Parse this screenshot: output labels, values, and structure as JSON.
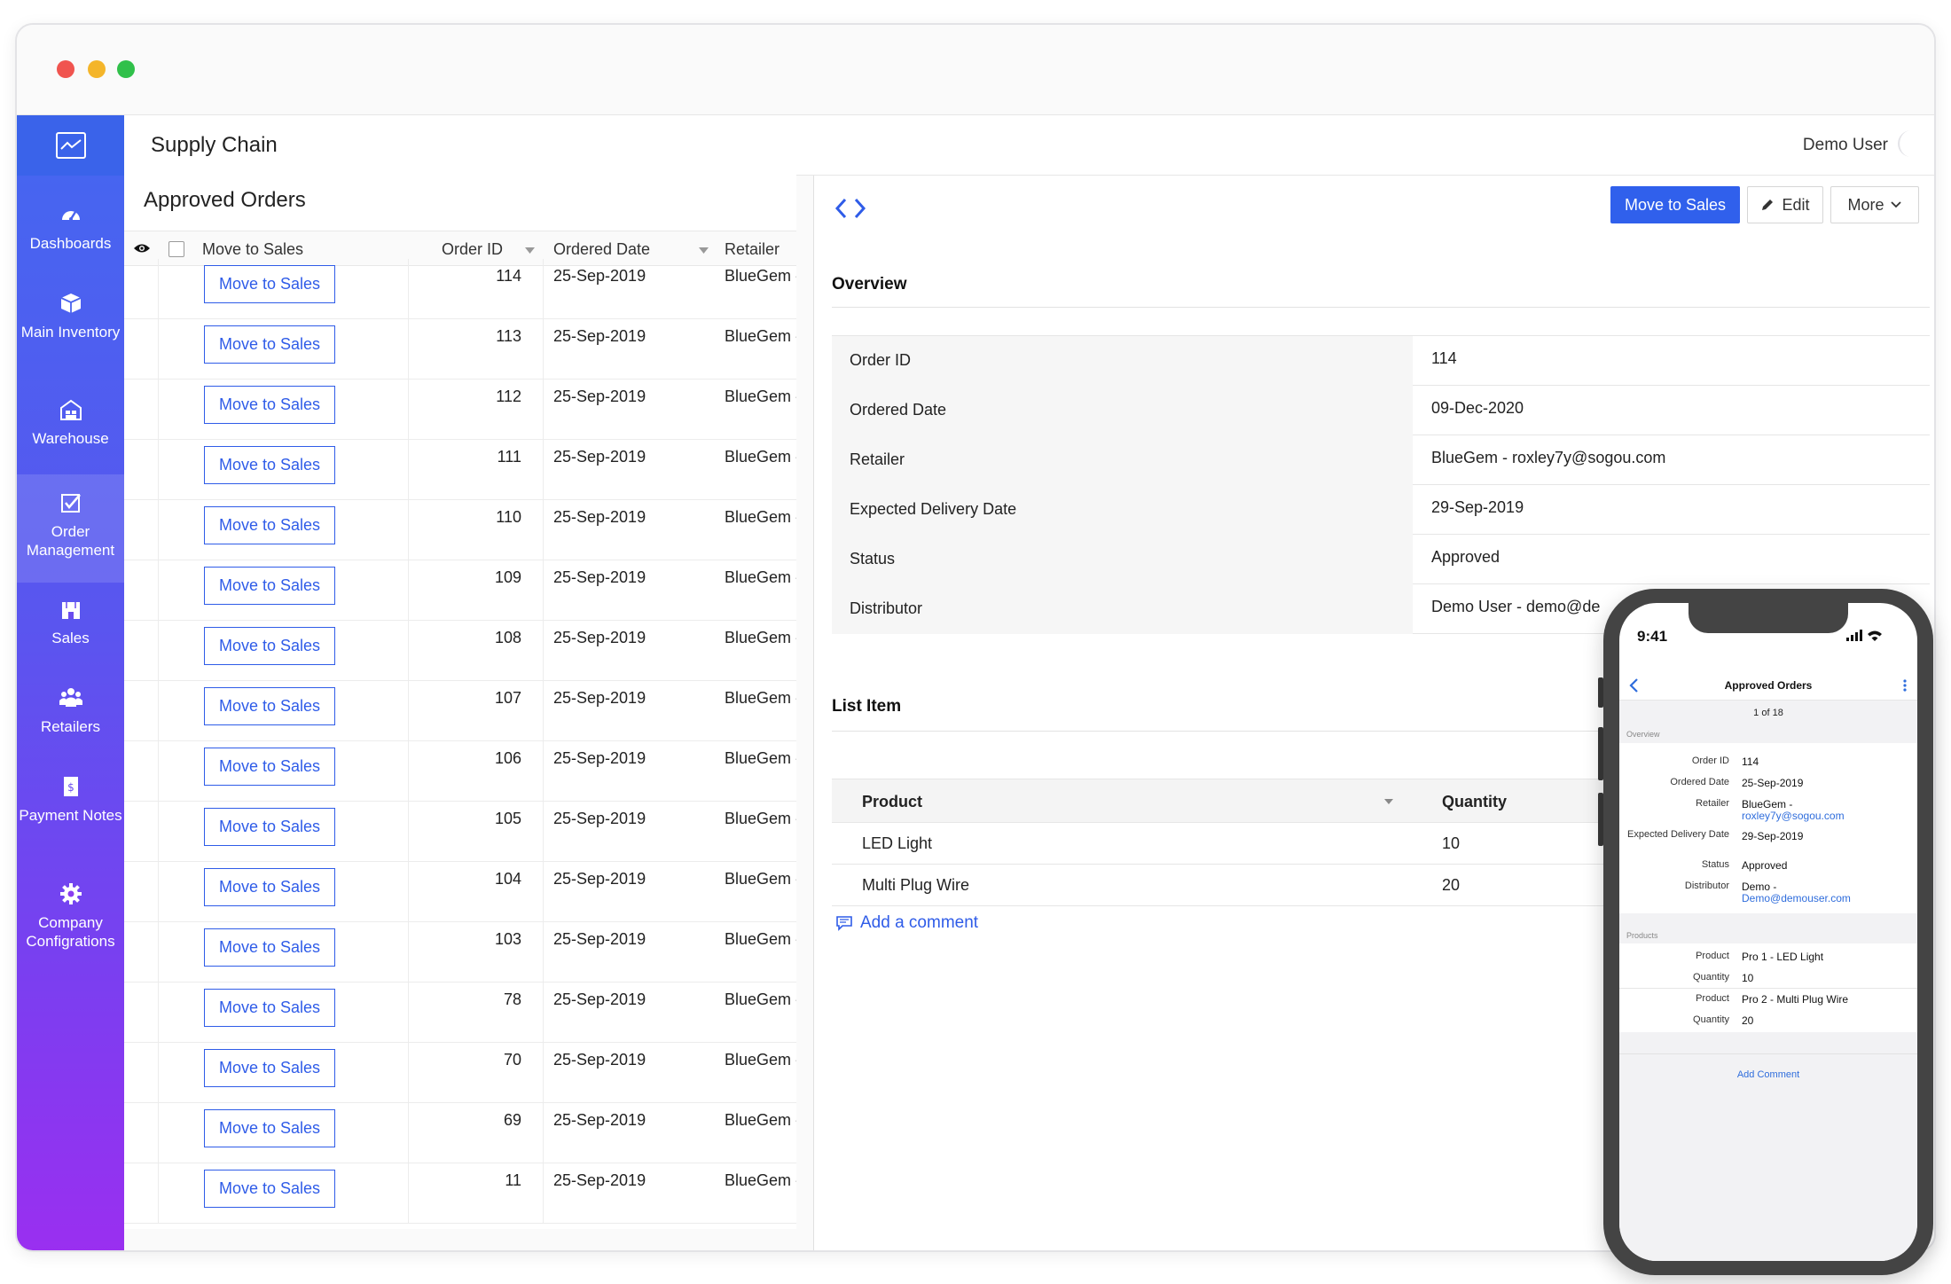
{
  "app": {
    "title": "Supply Chain",
    "user": "Demo User"
  },
  "sidebar": {
    "items": [
      {
        "label": "Dashboards",
        "icon": "gauge-icon"
      },
      {
        "label": "Main Inventory",
        "icon": "box-icon"
      },
      {
        "label": "Warehouse",
        "icon": "warehouse-icon"
      },
      {
        "label": "Order Management",
        "icon": "checkbox-icon",
        "active": true
      },
      {
        "label": "Sales",
        "icon": "store-icon"
      },
      {
        "label": "Retailers",
        "icon": "people-icon"
      },
      {
        "label": "Payment Notes",
        "icon": "dollar-note-icon"
      },
      {
        "label": "Company Configrations",
        "icon": "gear-icon"
      }
    ]
  },
  "list": {
    "title": "Approved Orders",
    "columns": [
      "Move to Sales",
      "Order ID",
      "Ordered Date",
      "Retailer"
    ],
    "button_label": "Move to Sales",
    "rows": [
      {
        "id": "114",
        "date": "25-Sep-2019",
        "retailer": "BlueGem -"
      },
      {
        "id": "113",
        "date": "25-Sep-2019",
        "retailer": "BlueGem -"
      },
      {
        "id": "112",
        "date": "25-Sep-2019",
        "retailer": "BlueGem -"
      },
      {
        "id": "111",
        "date": "25-Sep-2019",
        "retailer": "BlueGem -"
      },
      {
        "id": "110",
        "date": "25-Sep-2019",
        "retailer": "BlueGem -"
      },
      {
        "id": "109",
        "date": "25-Sep-2019",
        "retailer": "BlueGem -"
      },
      {
        "id": "108",
        "date": "25-Sep-2019",
        "retailer": "BlueGem -"
      },
      {
        "id": "107",
        "date": "25-Sep-2019",
        "retailer": "BlueGem -"
      },
      {
        "id": "106",
        "date": "25-Sep-2019",
        "retailer": "BlueGem -"
      },
      {
        "id": "105",
        "date": "25-Sep-2019",
        "retailer": "BlueGem -"
      },
      {
        "id": "104",
        "date": "25-Sep-2019",
        "retailer": "BlueGem -"
      },
      {
        "id": "103",
        "date": "25-Sep-2019",
        "retailer": "BlueGem -"
      },
      {
        "id": "78",
        "date": "25-Sep-2019",
        "retailer": "BlueGem -"
      },
      {
        "id": "70",
        "date": "25-Sep-2019",
        "retailer": "BlueGem -"
      },
      {
        "id": "69",
        "date": "25-Sep-2019",
        "retailer": "BlueGem -"
      },
      {
        "id": "11",
        "date": "25-Sep-2019",
        "retailer": "BlueGem -"
      }
    ]
  },
  "detail": {
    "actions": {
      "primary": "Move to Sales",
      "edit": "Edit",
      "more": "More"
    },
    "overview_title": "Overview",
    "overview": [
      {
        "label": "Order ID",
        "value": "114"
      },
      {
        "label": "Ordered Date",
        "value": "09-Dec-2020"
      },
      {
        "label": "Retailer",
        "value": "BlueGem - roxley7y@sogou.com"
      },
      {
        "label": "Expected Delivery Date",
        "value": "29-Sep-2019"
      },
      {
        "label": "Status",
        "value": "Approved"
      },
      {
        "label": "Distributor",
        "value": "Demo User - demo@de"
      }
    ],
    "list_item_title": "List Item",
    "list_item_columns": [
      "Product",
      "Quantity"
    ],
    "list_items": [
      {
        "product": "LED Light",
        "quantity": "10"
      },
      {
        "product": "Multi Plug Wire",
        "quantity": "20"
      }
    ],
    "add_comment": "Add a comment"
  },
  "phone": {
    "time": "9:41",
    "title": "Approved Orders",
    "pager": "1 of 18",
    "overview_label": "Overview",
    "fields": [
      {
        "label": "Order ID",
        "value": "114"
      },
      {
        "label": "Ordered Date",
        "value": "25-Sep-2019"
      },
      {
        "label": "Retailer",
        "value": "BlueGem -",
        "link": "roxley7y@sogou.com"
      },
      {
        "label": "Expected Delivery Date",
        "value": "29-Sep-2019"
      },
      {
        "label": "Status",
        "value": "Approved"
      },
      {
        "label": "Distributor",
        "value": "Demo -",
        "link": "Demo@demouser.com"
      }
    ],
    "products_label": "Products",
    "products": [
      {
        "product_label": "Product",
        "product": "Pro 1 - LED Light",
        "qty_label": "Quantity",
        "qty": "10"
      },
      {
        "product_label": "Product",
        "product": "Pro 2 - Multi Plug Wire",
        "qty_label": "Quantity",
        "qty": "20"
      }
    ],
    "add_comment": "Add Comment"
  },
  "colors": {
    "accent": "#3060ec",
    "sidebar_top": "#4467f0",
    "sidebar_bottom": "#9a2ff0"
  }
}
